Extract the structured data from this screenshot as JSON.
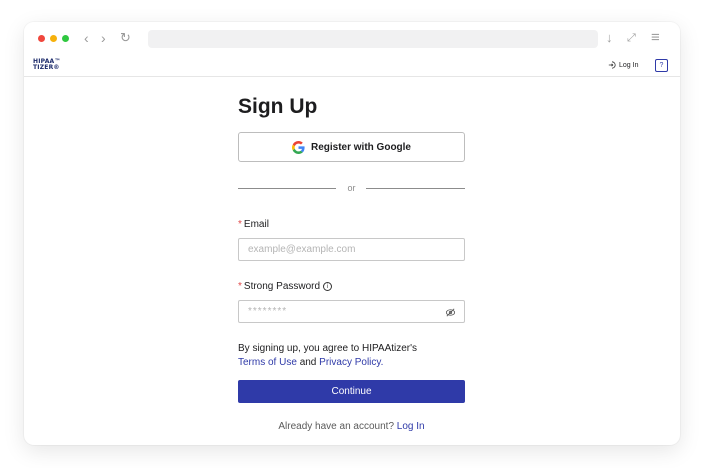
{
  "browser": {
    "back_icon": "‹",
    "forward_icon": "›",
    "reload_icon": "↻",
    "download_icon": "↓",
    "expand_icon": "⤢",
    "menu_icon": "≡"
  },
  "app": {
    "logo_line1": "HIPAA™",
    "logo_line2": "TIZER®",
    "login_label": "Log In",
    "help_icon": "?"
  },
  "form": {
    "title": "Sign Up",
    "google_button": "Register with Google",
    "divider": "or",
    "email_required": "*",
    "email_label": "Email",
    "email_placeholder": "example@example.com",
    "password_required": "*",
    "password_label": "Strong Password",
    "password_placeholder": "********",
    "agree_prefix": "By signing up, you agree to HIPAAtizer's",
    "terms_link": "Terms of Use",
    "agree_and": "and",
    "privacy_link": "Privacy Policy.",
    "continue_button": "Continue",
    "footer_text": "Already have an account?",
    "footer_link": "Log In"
  },
  "colors": {
    "accent": "#2f3aa8",
    "required": "#e04848",
    "traffic_red": "#f0473d",
    "traffic_yellow": "#f6b10c",
    "traffic_green": "#2fc840"
  }
}
